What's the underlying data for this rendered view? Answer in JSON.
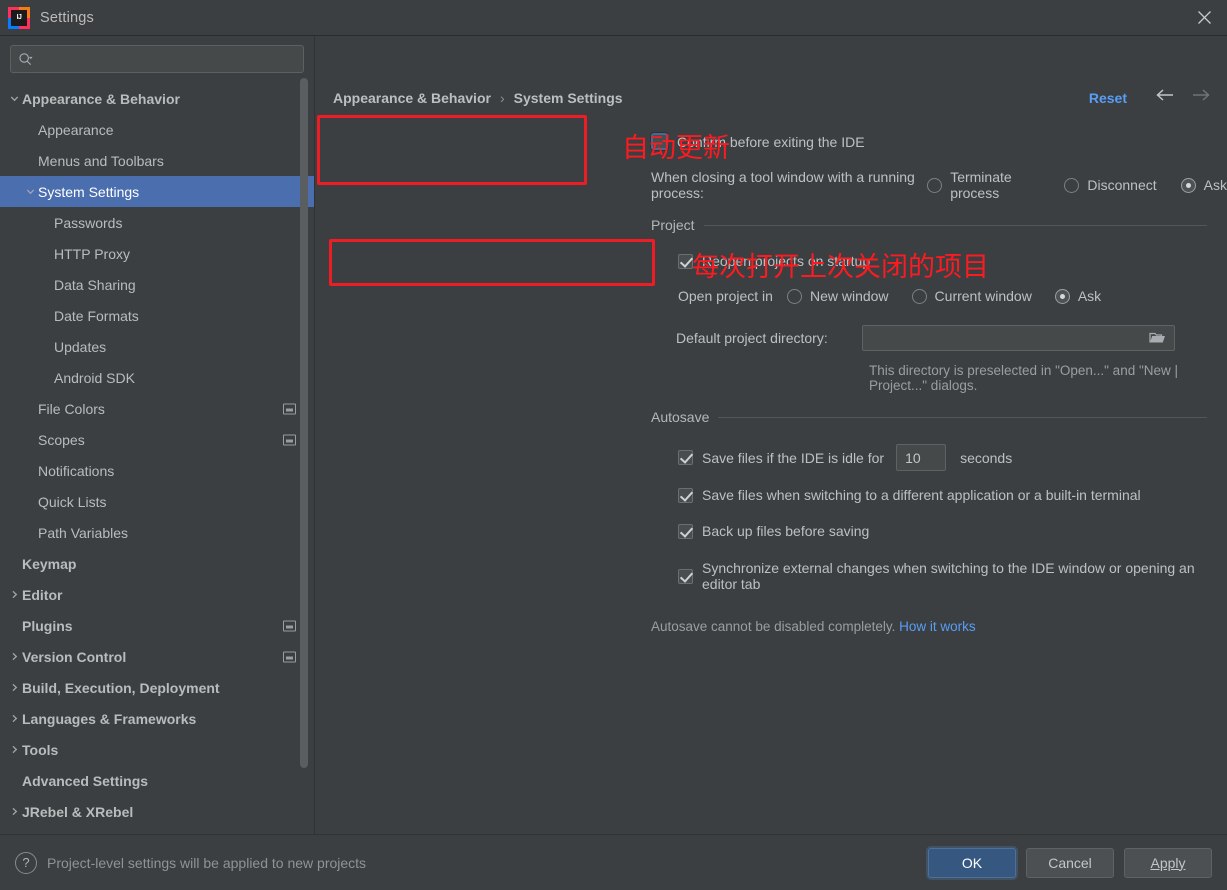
{
  "window": {
    "title": "Settings",
    "logo_text": "IJ",
    "close_icon": "close-icon"
  },
  "sidebar": {
    "search": {
      "value": "",
      "placeholder": "",
      "icon": "search-icon"
    },
    "items": [
      {
        "label": "Appearance & Behavior",
        "level": 0,
        "bold": true,
        "arrow": "chevron-down",
        "selected": false,
        "badge": false
      },
      {
        "label": "Appearance",
        "level": 1,
        "bold": false,
        "arrow": "none",
        "selected": false,
        "badge": false
      },
      {
        "label": "Menus and Toolbars",
        "level": 1,
        "bold": false,
        "arrow": "none",
        "selected": false,
        "badge": false
      },
      {
        "label": "System Settings",
        "level": 1,
        "bold": false,
        "arrow": "chevron-down",
        "selected": true,
        "badge": false
      },
      {
        "label": "Passwords",
        "level": 2,
        "bold": false,
        "arrow": "none",
        "selected": false,
        "badge": false
      },
      {
        "label": "HTTP Proxy",
        "level": 2,
        "bold": false,
        "arrow": "none",
        "selected": false,
        "badge": false
      },
      {
        "label": "Data Sharing",
        "level": 2,
        "bold": false,
        "arrow": "none",
        "selected": false,
        "badge": false
      },
      {
        "label": "Date Formats",
        "level": 2,
        "bold": false,
        "arrow": "none",
        "selected": false,
        "badge": false
      },
      {
        "label": "Updates",
        "level": 2,
        "bold": false,
        "arrow": "none",
        "selected": false,
        "badge": false
      },
      {
        "label": "Android SDK",
        "level": 2,
        "bold": false,
        "arrow": "none",
        "selected": false,
        "badge": false
      },
      {
        "label": "File Colors",
        "level": 1,
        "bold": false,
        "arrow": "none",
        "selected": false,
        "badge": true
      },
      {
        "label": "Scopes",
        "level": 1,
        "bold": false,
        "arrow": "none",
        "selected": false,
        "badge": true
      },
      {
        "label": "Notifications",
        "level": 1,
        "bold": false,
        "arrow": "none",
        "selected": false,
        "badge": false
      },
      {
        "label": "Quick Lists",
        "level": 1,
        "bold": false,
        "arrow": "none",
        "selected": false,
        "badge": false
      },
      {
        "label": "Path Variables",
        "level": 1,
        "bold": false,
        "arrow": "none",
        "selected": false,
        "badge": false
      },
      {
        "label": "Keymap",
        "level": 0,
        "bold": true,
        "arrow": "none",
        "selected": false,
        "badge": false
      },
      {
        "label": "Editor",
        "level": 0,
        "bold": true,
        "arrow": "chevron-right",
        "selected": false,
        "badge": false
      },
      {
        "label": "Plugins",
        "level": 0,
        "bold": true,
        "arrow": "none",
        "selected": false,
        "badge": true
      },
      {
        "label": "Version Control",
        "level": 0,
        "bold": true,
        "arrow": "chevron-right",
        "selected": false,
        "badge": true
      },
      {
        "label": "Build, Execution, Deployment",
        "level": 0,
        "bold": true,
        "arrow": "chevron-right",
        "selected": false,
        "badge": false
      },
      {
        "label": "Languages & Frameworks",
        "level": 0,
        "bold": true,
        "arrow": "chevron-right",
        "selected": false,
        "badge": false
      },
      {
        "label": "Tools",
        "level": 0,
        "bold": true,
        "arrow": "chevron-right",
        "selected": false,
        "badge": false
      },
      {
        "label": "Advanced Settings",
        "level": 0,
        "bold": true,
        "arrow": "none",
        "selected": false,
        "badge": false
      },
      {
        "label": "JRebel & XRebel",
        "level": 0,
        "bold": true,
        "arrow": "chevron-right",
        "selected": false,
        "badge": false
      }
    ]
  },
  "main": {
    "breadcrumb": {
      "parent": "Appearance & Behavior",
      "separator": "›",
      "current": "System Settings"
    },
    "reset_label": "Reset",
    "nav": {
      "back_icon": "arrow-left-icon",
      "forward_icon": "arrow-right-icon"
    },
    "confirm_exit": {
      "label": "Confirm before exiting the IDE",
      "checked": false
    },
    "tool_window": {
      "label": "When closing a tool window with a running process:",
      "options": [
        "Terminate process",
        "Disconnect",
        "Ask"
      ],
      "selected": "Ask"
    },
    "project": {
      "group_title": "Project",
      "reopen": {
        "label": "Reopen projects on startup",
        "checked": true
      },
      "open_project_in": {
        "label": "Open project in",
        "options": [
          "New window",
          "Current window",
          "Ask"
        ],
        "selected": "Ask"
      },
      "default_dir": {
        "label": "Default project directory:",
        "value": "",
        "folder_icon": "folder-icon"
      },
      "hint": "This directory is preselected in \"Open...\" and \"New | Project...\" dialogs."
    },
    "autosave": {
      "group_title": "Autosave",
      "idle": {
        "label_before": "Save files if the IDE is idle for",
        "value": "10",
        "label_after": "seconds",
        "checked": true
      },
      "items": [
        {
          "label": "Save files when switching to a different application or a built-in terminal",
          "checked": true
        },
        {
          "label": "Back up files before saving",
          "checked": true
        },
        {
          "label": "Synchronize external changes when switching to the IDE window or opening an editor tab",
          "checked": true
        }
      ],
      "note": "Autosave cannot be disabled completely.",
      "note_link": "How it works"
    },
    "annotations": [
      {
        "text": "自动更新"
      },
      {
        "text": "每次打开上次关闭的项目"
      }
    ]
  },
  "footer": {
    "help_icon": "?",
    "note": "Project-level settings will be applied to new projects",
    "ok": "OK",
    "cancel": "Cancel",
    "apply": "Apply"
  },
  "colors": {
    "background": "#3c3f41",
    "selection": "#4b6eaf",
    "accent_link": "#589df6",
    "annotation_red": "#ee1c25",
    "primary_button": "#365880"
  }
}
